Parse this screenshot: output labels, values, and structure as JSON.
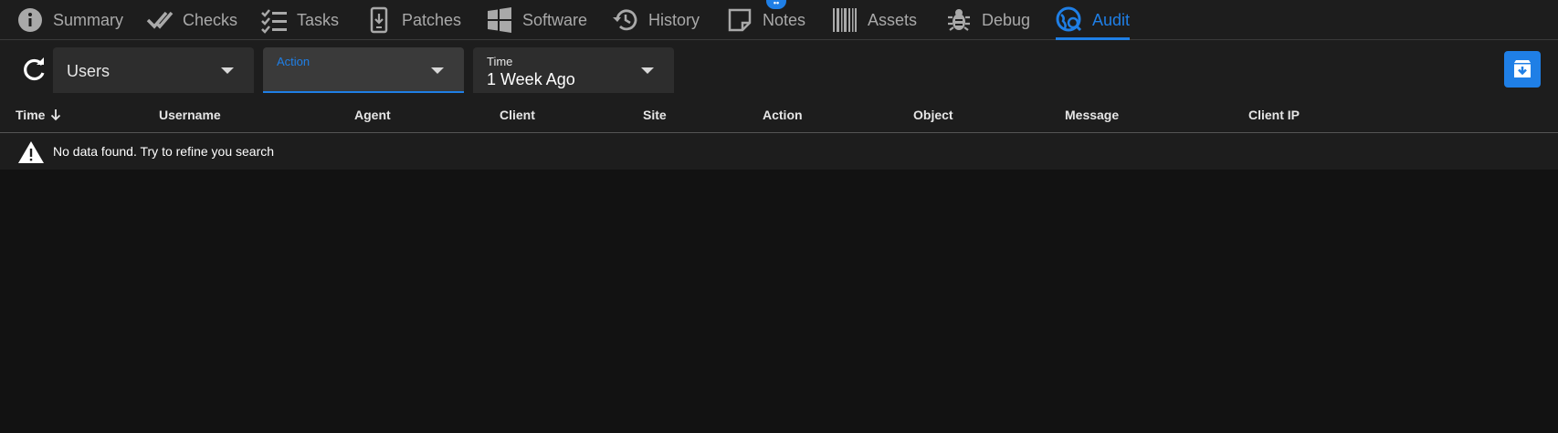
{
  "tabs": [
    {
      "label": "Summary",
      "icon": "info-icon"
    },
    {
      "label": "Checks",
      "icon": "double-check-icon"
    },
    {
      "label": "Tasks",
      "icon": "checklist-icon"
    },
    {
      "label": "Patches",
      "icon": "phone-download-icon"
    },
    {
      "label": "Software",
      "icon": "windows-icon"
    },
    {
      "label": "History",
      "icon": "history-icon"
    },
    {
      "label": "Notes",
      "icon": "note-icon"
    },
    {
      "label": "Assets",
      "icon": "barcode-icon"
    },
    {
      "label": "Debug",
      "icon": "bug-icon"
    },
    {
      "label": "Audit",
      "icon": "globe-search-icon",
      "active": true
    }
  ],
  "accent_color": "#1f7fe6",
  "filters": {
    "users": {
      "label": "Users"
    },
    "action": {
      "label": "Action",
      "value": ""
    },
    "time": {
      "label": "Time",
      "value": "1 Week Ago"
    }
  },
  "table": {
    "columns": [
      "Time",
      "Username",
      "Agent",
      "Client",
      "Site",
      "Action",
      "Object",
      "Message",
      "Client IP"
    ],
    "sorted_column": "Time",
    "sort_direction": "descending",
    "empty_message": "No data found. Try to refine you search"
  }
}
